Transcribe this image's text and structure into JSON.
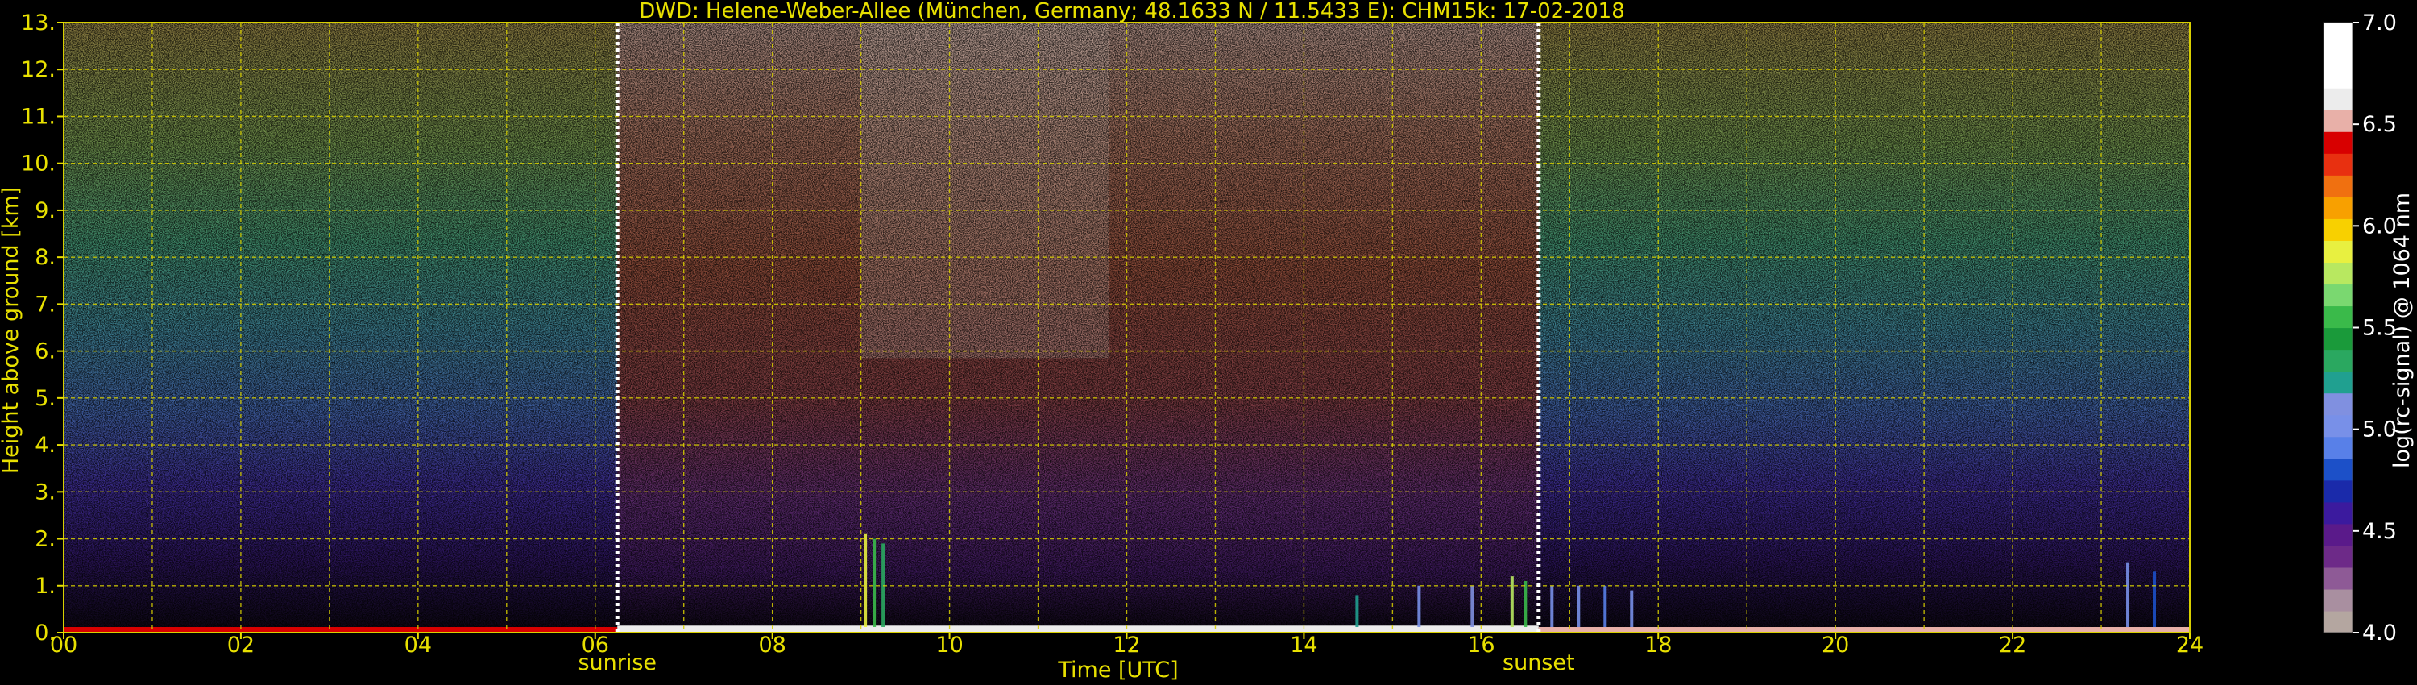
{
  "chart_data": {
    "type": "heatmap",
    "title": "DWD: Helene-Weber-Allee (München, Germany; 48.1633 N / 11.5433 E):    CHM15k: 17-02-2018",
    "xlabel": "Time [UTC]",
    "ylabel": "Height above ground [km]",
    "xlim": [
      0,
      24
    ],
    "ylim": [
      0,
      13
    ],
    "x_ticks": [
      "00",
      "02",
      "04",
      "06",
      "08",
      "10",
      "12",
      "14",
      "16",
      "18",
      "20",
      "22",
      "24"
    ],
    "y_ticks": [
      "0.",
      "1.",
      "2.",
      "3.",
      "4.",
      "5.",
      "6.",
      "7.",
      "8.",
      "9.",
      "10.",
      "11.",
      "12.",
      "13."
    ],
    "x_gridlines": [
      1,
      2,
      3,
      4,
      5,
      6,
      7,
      8,
      9,
      10,
      11,
      12,
      13,
      14,
      15,
      16,
      17,
      18,
      19,
      20,
      21,
      22,
      23
    ],
    "y_gridlines": [
      1,
      2,
      3,
      4,
      5,
      6,
      7,
      8,
      9,
      10,
      11,
      12
    ],
    "grid": true,
    "annotations": [
      {
        "label": "sunrise",
        "time": 6.25
      },
      {
        "label": "sunset",
        "time": 16.65
      }
    ],
    "colorbar": {
      "label": "log(rc-signal) @ 1064 nm",
      "range": [
        4.0,
        7.0
      ],
      "ticks": [
        "4.0",
        "4.5",
        "5.0",
        "5.5",
        "6.0",
        "6.5",
        "7.0"
      ],
      "colors": [
        "#b4a6a0",
        "#a98fa0",
        "#8e5a96",
        "#6d2a88",
        "#5a1a8a",
        "#3b1a9e",
        "#1a2aaa",
        "#1c50c8",
        "#5880e8",
        "#7890e8",
        "#8090e0",
        "#20a090",
        "#2aa860",
        "#1a9a3a",
        "#3aba4a",
        "#7ad870",
        "#b8e860",
        "#e8f040",
        "#f8d000",
        "#f8a000",
        "#f07010",
        "#e83010",
        "#d80000",
        "#e8b0a8",
        "#ececec",
        "#ffffff",
        "#ffffff",
        "#ffffff"
      ]
    },
    "layers": [
      {
        "t0": 0.0,
        "t1": 6.25,
        "h": [
          0.0,
          0.12
        ],
        "level": 6.4
      },
      {
        "t0": 6.25,
        "t1": 16.65,
        "h": [
          0.0,
          0.15
        ],
        "level": 6.6
      },
      {
        "t0": 16.65,
        "t1": 24.0,
        "h": [
          0.0,
          0.12
        ],
        "level": 6.5
      }
    ],
    "cloud_spikes": [
      {
        "time": 9.05,
        "top": 2.1,
        "level": 5.9
      },
      {
        "time": 9.15,
        "top": 2.0,
        "level": 5.6
      },
      {
        "time": 9.25,
        "top": 1.9,
        "level": 5.3
      },
      {
        "time": 14.6,
        "top": 0.8,
        "level": 5.2
      },
      {
        "time": 15.3,
        "top": 1.0,
        "level": 5.0
      },
      {
        "time": 15.9,
        "top": 1.0,
        "level": 5.1
      },
      {
        "time": 16.35,
        "top": 1.2,
        "level": 5.8
      },
      {
        "time": 16.5,
        "top": 1.1,
        "level": 5.5
      },
      {
        "time": 16.8,
        "top": 1.0,
        "level": 5.0
      },
      {
        "time": 17.1,
        "top": 1.0,
        "level": 5.0
      },
      {
        "time": 17.4,
        "top": 1.0,
        "level": 4.9
      },
      {
        "time": 17.7,
        "top": 0.9,
        "level": 5.0
      },
      {
        "time": 23.3,
        "top": 1.5,
        "level": 5.0
      },
      {
        "time": 23.6,
        "top": 1.3,
        "level": 4.8
      }
    ]
  }
}
